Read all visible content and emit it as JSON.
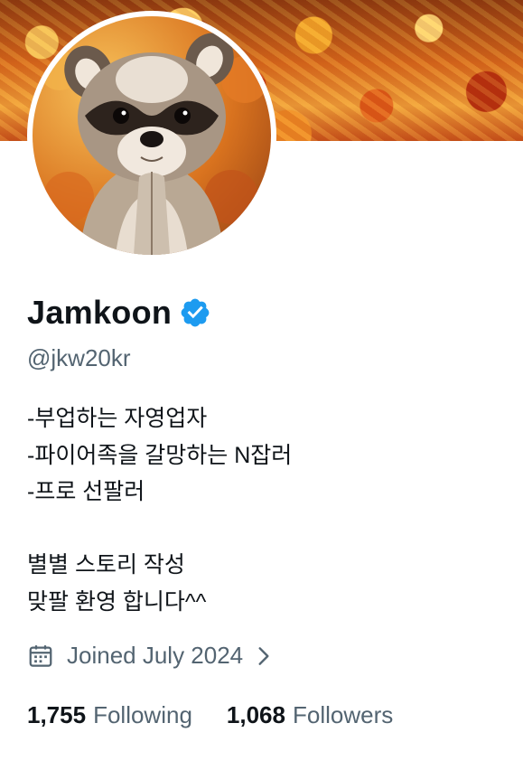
{
  "profile": {
    "name": "Jamkoon",
    "handle": "@jkw20kr",
    "verified_color": "#1d9bf0",
    "bio_lines": [
      "-부업하는 자영업자",
      "-파이어족을 갈망하는 N잡러",
      "-프로 선팔러",
      "",
      "별별 스토리 작성",
      "맞팔 환영 합니다^^"
    ],
    "joined": "Joined July 2024",
    "following_count": "1,755",
    "following_label": "Following",
    "followers_count": "1,068",
    "followers_label": "Followers"
  },
  "icons": {
    "verified": "verified-badge-icon",
    "calendar": "calendar-icon",
    "chevron": "chevron-right-icon"
  }
}
